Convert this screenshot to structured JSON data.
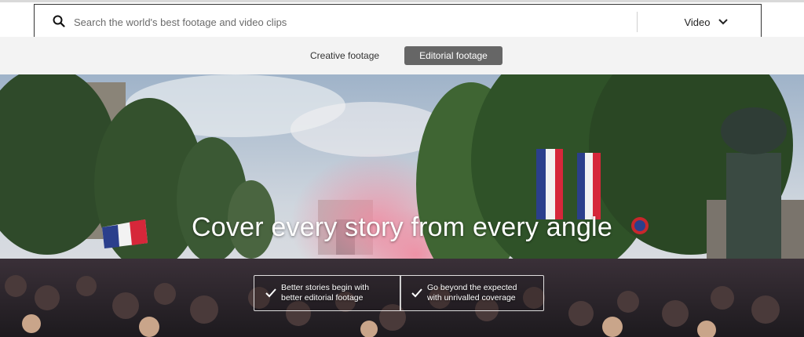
{
  "search": {
    "placeholder": "Search the world's best footage and video clips",
    "type_label": "Video"
  },
  "tabs": [
    {
      "label": "Creative footage",
      "active": false
    },
    {
      "label": "Editorial footage",
      "active": true
    }
  ],
  "hero": {
    "title": "Cover every story from every angle",
    "benefits": [
      {
        "line1": "Better stories begin with",
        "line2": "better editorial footage"
      },
      {
        "line1": "Go beyond the expected",
        "line2": "with unrivalled coverage"
      }
    ]
  },
  "colors": {
    "active_tab_bg": "#666666",
    "tabs_band_bg": "#f3f3f3",
    "search_border": "#333333"
  },
  "icons": [
    "search-icon",
    "chevron-down-icon",
    "check-icon"
  ]
}
